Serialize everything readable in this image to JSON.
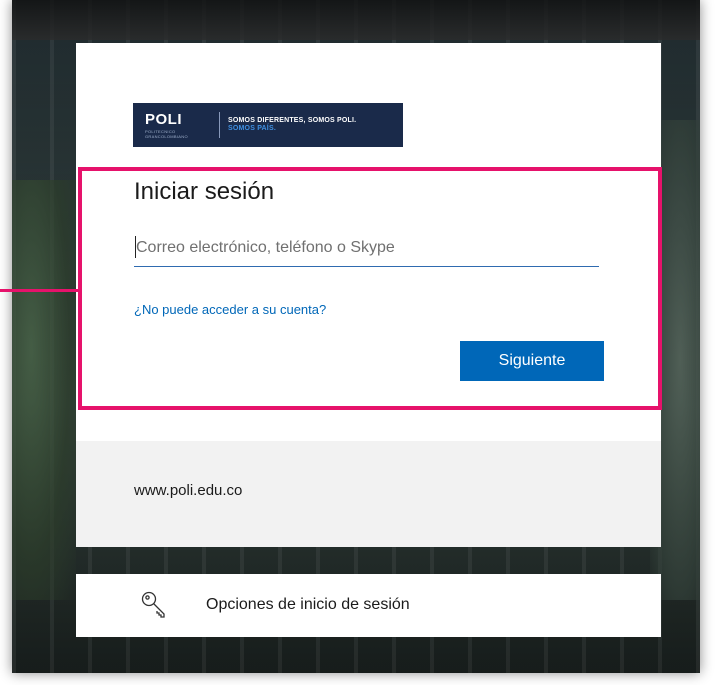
{
  "logo": {
    "brand": "POLI",
    "tagline_small": "POLITECNICO GRANCOLOMBIANO",
    "slogan_line1": "SOMOS DIFERENTES, SOMOS POLI.",
    "slogan_line2": "SOMOS PAÍS."
  },
  "signin": {
    "title": "Iniciar sesión",
    "email_placeholder": "Correo electrónico, teléfono o Skype",
    "email_value": "",
    "cant_access_link": "¿No puede acceder a su cuenta?",
    "next_label": "Siguiente"
  },
  "footer": {
    "website": "www.poli.edu.co"
  },
  "options": {
    "label": "Opciones de inicio de sesión",
    "icon": "key-icon"
  },
  "colors": {
    "accent": "#0067b8",
    "highlight": "#e6126b",
    "logo_bg": "#1a2a4a"
  }
}
